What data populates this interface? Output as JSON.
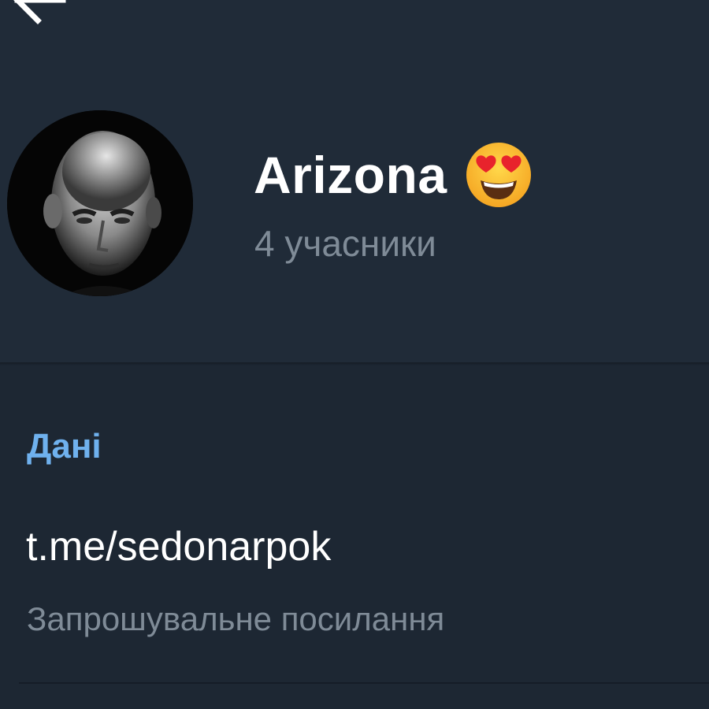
{
  "header": {
    "back_icon": "arrow-left-icon",
    "avatar_icon": "group-avatar-photo",
    "title": "Arizona",
    "title_emoji_icon": "smiling-face-with-heart-eyes-icon",
    "member_count": "4 учасники"
  },
  "info": {
    "section_title": "Дані",
    "invite_link": "t.me/sedonarpok",
    "invite_caption": "Запрошувальне посилання"
  },
  "colors": {
    "header_background": "#202b38",
    "body_background": "#1d2733",
    "accent": "#6fb1ee",
    "secondary_text": "#7f8b97"
  }
}
